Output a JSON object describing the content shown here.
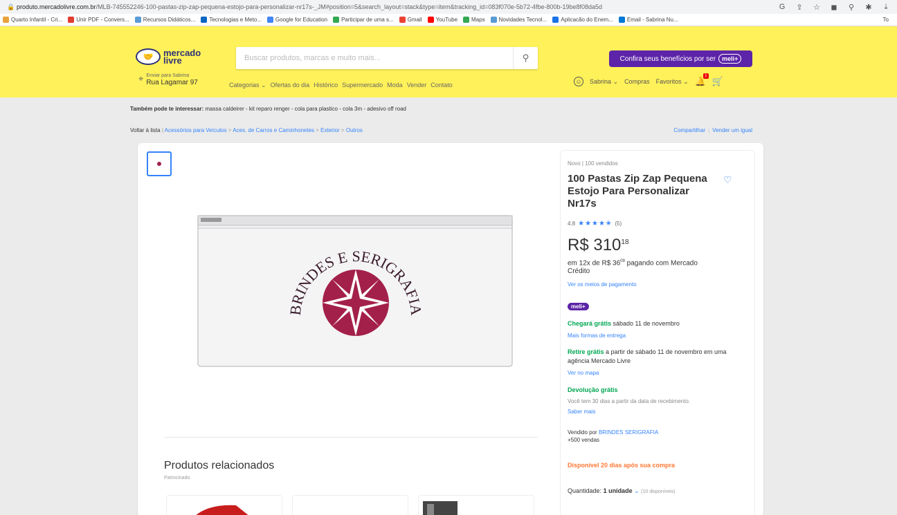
{
  "browser": {
    "url_host": "produto.mercadolivre.com.br",
    "url_path": "/MLB-745552246-100-pastas-zip-zap-pequena-estojo-para-personalizar-nr17s-_JM#position=5&search_layout=stack&type=item&tracking_id=083f070e-5b72-4fbe-800b-19be8f08da5d",
    "bookmarks": [
      {
        "label": "Quarto Infantil - Cri...",
        "color": "#e8a33d"
      },
      {
        "label": "Unir PDF - Convers...",
        "color": "#e03c31"
      },
      {
        "label": "Recursos Didáticos...",
        "color": "#5a9bd5"
      },
      {
        "label": "Tecnologias e Meto...",
        "color": "#0a66c2"
      },
      {
        "label": "Google for Education",
        "color": "#4285f4"
      },
      {
        "label": "Participar de uma s...",
        "color": "#34a853"
      },
      {
        "label": "Gmail",
        "color": "#ea4335"
      },
      {
        "label": "YouTube",
        "color": "#ff0000"
      },
      {
        "label": "Maps",
        "color": "#34a853"
      },
      {
        "label": "Novidades Tecnol...",
        "color": "#5a9bd5"
      },
      {
        "label": "Aplicacão do Enem...",
        "color": "#1a73e8"
      },
      {
        "label": "Email - Sabrina Nu...",
        "color": "#0078d4"
      }
    ],
    "bookmark_end": "To"
  },
  "header": {
    "logo_line1": "mercado",
    "logo_line2": "livre",
    "search_placeholder": "Buscar produtos, marcas e muito mais...",
    "meli_banner": "Confira seus benefícios por ser",
    "meli_pill": "meli+",
    "delivery_small": "Enviar para Sabrina",
    "delivery_address": "Rua Lagamar 97",
    "nav": [
      "Categorias ⌄",
      "Ofertas do dia",
      "Histórico",
      "Supermercado",
      "Moda",
      "Vender",
      "Contato"
    ],
    "user": "Sabrina ⌄",
    "purchases": "Compras",
    "favorites": "Favoritos ⌄",
    "notif_count": "1"
  },
  "page": {
    "suggest_label": "Também pode te interessar:",
    "suggest_items": "massa caldeirer - kit reparo renger - cola para plastico - cola 3m - adesivo off road",
    "breadcrumb_back": "Voltar à lista",
    "breadcrumb": [
      "Acessórios para Veículos",
      "Aces. de Carros e Caminhonetes",
      "Exterior",
      "Outros"
    ],
    "share": "Compartilhar",
    "sell_same": "Vender um igual",
    "image_text": "BRINDES E SERIGRAFIA",
    "related_title": "Produtos relacionados",
    "related_sub": "Patrocinado"
  },
  "product": {
    "condition": "Novo  |  100 vendidos",
    "title": "100 Pastas Zip Zap Pequena Estojo Para Personalizar Nr17s",
    "rating_value": "4.8",
    "stars": "★★★★✬",
    "rating_count": "(5)",
    "price_int": "R$ 310",
    "price_cents": "18",
    "installments_pre": "em 12x de R$ 36",
    "installments_cents": "09",
    "installments_post": " pagando com Mercado Crédito",
    "payment_link": "Ver os meios de pagamento",
    "meli_tag": "meli+",
    "shipping_green": "Chegará grátis",
    "shipping_rest": " sábado 11 de novembro",
    "shipping_link": "Mais formas de entrega",
    "pickup_green": "Retire grátis",
    "pickup_rest": " a partir de sábado 11 de novembro em uma agência Mercado Livre",
    "pickup_link": "Ver no mapa",
    "return_title": "Devolução grátis",
    "return_text": "Você tem 30 dias a partir da data de recebimento.",
    "return_link": "Saber mais",
    "seller_pre": "Vendido por",
    "seller_name": "BRINDES SERIGRAFIA",
    "seller_sales": "+500 vendas",
    "availability": "Disponível 20 dias após sua compra",
    "qty_label": "Quantidade:",
    "qty_value": "1 unidade",
    "qty_stock": "(10 disponíveis)"
  }
}
